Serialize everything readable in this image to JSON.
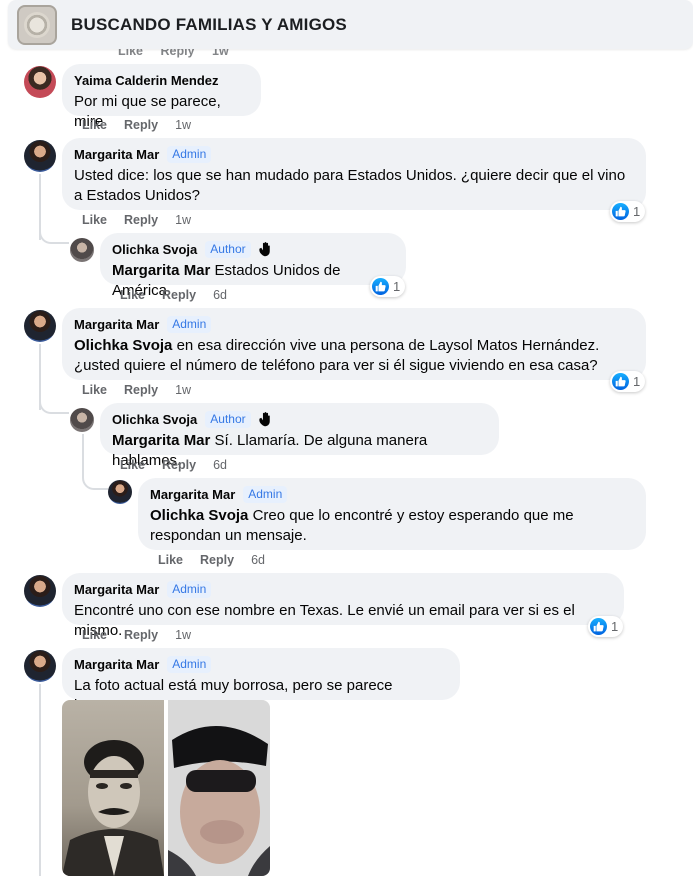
{
  "header": {
    "title": "BUSCANDO FAMILIAS Y AMIGOS",
    "logo_icon": "group-emblem-icon"
  },
  "ghost_actions": {
    "like": "Like",
    "reply": "Reply",
    "time": "1w"
  },
  "labels": {
    "like": "Like",
    "reply": "Reply",
    "admin": "Admin",
    "author": "Author"
  },
  "comments": [
    {
      "author": "Yaima Calderin Mendez",
      "text": "Por mi que se parece, mire",
      "time": "1w"
    },
    {
      "author": "Margarita Mar",
      "badge": "Admin",
      "text": "Usted dice: los que se han mudado para Estados Unidos. ¿quiere decir que el vino a Estados Unidos?",
      "time": "1w",
      "reactions": "1",
      "replies": [
        {
          "author": "Olichka Svoja",
          "badge": "Author",
          "mention": "Margarita Mar",
          "text": "Estados Unidos de América",
          "time": "6d",
          "reactions": "1"
        }
      ]
    },
    {
      "author": "Margarita Mar",
      "badge": "Admin",
      "mention": "Olichka Svoja",
      "text": "en esa dirección vive una persona de Laysol Matos Hernández. ¿usted quiere el número de teléfono para ver si él sigue viviendo en esa casa?",
      "time": "1w",
      "reactions": "1",
      "replies": [
        {
          "author": "Olichka Svoja",
          "badge": "Author",
          "mention": "Margarita Mar",
          "text": "Sí. Llamaría. De alguna manera hablamos.",
          "time": "6d"
        },
        {
          "author": "Margarita Mar",
          "badge": "Admin",
          "mention": "Olichka Svoja",
          "text": "Creo que lo encontré y estoy esperando que me respondan un mensaje.",
          "time": "6d"
        }
      ]
    },
    {
      "author": "Margarita Mar",
      "badge": "Admin",
      "text": "Encontré uno con ese nombre en Texas. Le envié un email para ver si es el mismo.",
      "time": "1w",
      "reactions": "1"
    },
    {
      "author": "Margarita Mar",
      "badge": "Admin",
      "text": "La foto actual está muy borrosa, pero se parece bastante",
      "photos": [
        "photo-old-portrait",
        "photo-current-selfie"
      ]
    }
  ],
  "colors": {
    "bubble": "#f0f2f5",
    "badge_text": "#3578e5",
    "badge_bg": "#e7f0fd",
    "like_blue": "#0866ff",
    "meta_gray": "#65676b"
  }
}
